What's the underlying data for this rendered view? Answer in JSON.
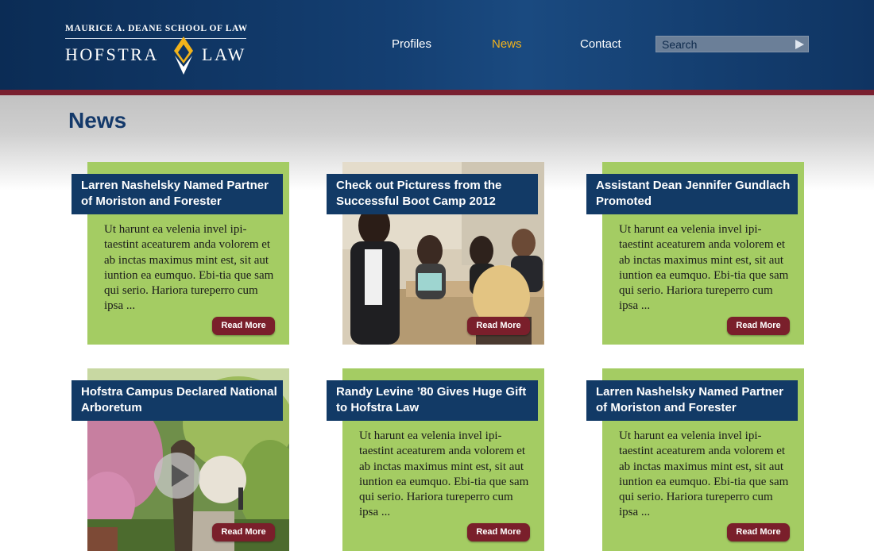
{
  "logo": {
    "school": "MAURICE A. DEANE SCHOOL OF LAW",
    "left": "HOFSTRA",
    "right": "LAW"
  },
  "nav": {
    "items": [
      {
        "label": "Profiles",
        "active": false
      },
      {
        "label": "News",
        "active": true
      },
      {
        "label": "Contact",
        "active": false
      }
    ]
  },
  "search": {
    "placeholder": "Search"
  },
  "page": {
    "title": "News"
  },
  "cards": [
    {
      "title": "Larren Nashelsky Named Partner of Moriston and Forester",
      "body": "Ut harunt ea velenia invel ipi-taestint aceaturem anda volorem et ab inctas maximus mint est, sit aut iuntion ea eumquo. Ebi-tia que sam qui serio. Hariora tureperro cum ipsa ...",
      "button": "Read More"
    },
    {
      "title": "Check out Picturess from  the Successful Boot Camp 2012",
      "button": "Read More"
    },
    {
      "title": "Assistant Dean Jennifer Gundlach Promoted",
      "body": "Ut harunt ea velenia invel ipi-taestint aceaturem anda volorem et ab inctas maximus mint est, sit aut iuntion ea eumquo. Ebi-tia que sam qui serio. Hariora tureperro cum ipsa ...",
      "button": "Read More"
    },
    {
      "title": "Hofstra Campus Declared National Arboretum",
      "button": "Read More"
    },
    {
      "title": "Randy Levine ’80 Gives Huge Gift to Hofstra Law",
      "body": "Ut harunt ea velenia invel ipi-taestint aceaturem anda volorem et ab inctas maximus mint est, sit aut iuntion ea eumquo. Ebi-tia que sam qui serio. Hariora tureperro cum ipsa ...",
      "button": "Read More"
    },
    {
      "title": "Larren Nashelsky Named Partner of Moriston and Forester",
      "body": "Ut harunt ea velenia invel ipi-taestint aceaturem anda volorem et ab inctas maximus mint est, sit aut iuntion ea eumquo. Ebi-tia que sam qui serio. Hariora tureperro cum ipsa ...",
      "button": "Read More"
    }
  ],
  "colors": {
    "header": "#143f72",
    "stripe": "#7a2030",
    "card_green": "#a4cc63",
    "title_bar": "#123a66",
    "button": "#7a1f2b",
    "nav_active": "#f2b31b"
  }
}
